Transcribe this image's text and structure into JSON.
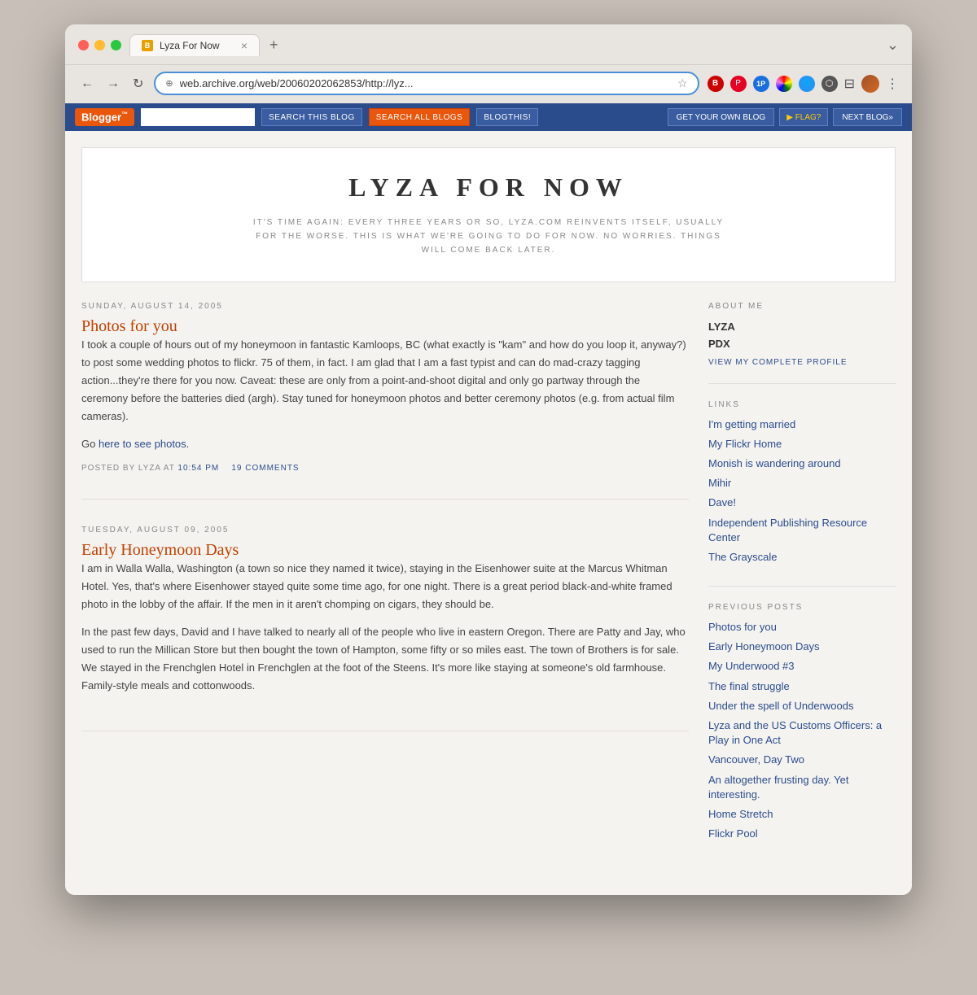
{
  "browser": {
    "tab_favicon": "B",
    "tab_title": "Lyza For Now",
    "tab_close": "×",
    "tab_add": "+",
    "tab_menu": "⌄",
    "nav_back": "←",
    "nav_forward": "→",
    "nav_refresh": "↻",
    "address_lock": "⊕",
    "address_url": "web.archive.org/web/20060202062853/http://lyz...",
    "address_star": "☆",
    "toolbar_more": "···"
  },
  "blogger_nav": {
    "logo": "Blogger",
    "logo_sup": "™",
    "search_placeholder": "",
    "btn_search_this": "Search This Blog",
    "btn_search_all": "Search All Blogs",
    "btn_blogthis": "BlogThis!",
    "btn_get_blog": "Get Your Own Blog",
    "btn_flag": "▶ FLAG?",
    "btn_next": "NEXT BLOG»"
  },
  "blog": {
    "title": "LYZA FOR NOW",
    "subtitle": "IT'S TIME AGAIN: EVERY THREE YEARS OR SO, LYZA.COM REINVENTS ITSELF, USUALLY FOR THE WORSE. THIS IS WHAT WE'RE GOING TO DO FOR NOW. NO WORRIES. THINGS WILL COME BACK LATER."
  },
  "posts": [
    {
      "date": "SUNDAY, AUGUST 14, 2005",
      "title": "Photos for you",
      "body_paragraphs": [
        "I took a couple of hours out of my honeymoon in fantastic Kamloops, BC (what exactly is \"kam\" and how do you loop it, anyway?) to post some wedding photos to flickr. 75 of them, in fact. I am glad that I am a fast typist and can do mad-crazy tagging action...they're there for you now. Caveat: these are only from a point-and-shoot digital and only go partway through the ceremony before the batteries died (argh). Stay tuned for honeymoon photos and better ceremony photos (e.g. from actual film cameras).",
        "Go here to see photos."
      ],
      "link_text": "here to see photos",
      "posted_by": "POSTED BY LYZA AT",
      "time": "10:54 PM",
      "comments": "19 COMMENTS"
    },
    {
      "date": "TUESDAY, AUGUST 09, 2005",
      "title": "Early Honeymoon Days",
      "body_paragraphs": [
        "I am in Walla Walla, Washington (a town so nice they named it twice), staying in the Eisenhower suite at the Marcus Whitman Hotel. Yes, that's where Eisenhower stayed quite some time ago, for one night. There is a great period black-and-white framed photo in the lobby of the affair. If the men in it aren't chomping on cigars, they should be.",
        "In the past few days, David and I have talked to nearly all of the people who live in eastern Oregon. There are Patty and Jay, who used to run the Millican Store but then bought the town of Hampton, some fifty or so miles east. The town of Brothers is for sale. We stayed in the Frenchglen Hotel in Frenchglen at the foot of the Steens. It's more like staying at someone's old farmhouse. Family-style meals and cottonwoods."
      ]
    }
  ],
  "sidebar": {
    "about_heading": "ABOUT ME",
    "profile_name_line1": "LYZA",
    "profile_name_line2": "PDX",
    "view_profile": "VIEW MY COMPLETE PROFILE",
    "links_heading": "LINKS",
    "links": [
      "I'm getting married",
      "My Flickr Home",
      "Monish is wandering around",
      "Mihir",
      "Dave!",
      "Independent Publishing Resource Center",
      "The Grayscale"
    ],
    "prev_posts_heading": "PREVIOUS POSTS",
    "prev_posts": [
      "Photos for you",
      "Early Honeymoon Days",
      "My Underwood #3",
      "The final struggle",
      "Under the spell of Underwoods",
      "Lyza and the US Customs Officers: a Play in One Act",
      "Vancouver, Day Two",
      "An altogether frusting day. Yet interesting.",
      "Home Stretch",
      "Flickr Pool"
    ]
  }
}
